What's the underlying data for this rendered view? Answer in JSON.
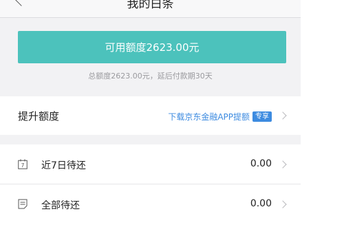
{
  "nav": {
    "title": "我的白条",
    "back_icon": "chevron-left-icon"
  },
  "quota": {
    "button_label": "可用额度2623.00元",
    "description": "总额度2623.00元，延后付款期30天",
    "accent_color": "#4cc2bc"
  },
  "raise": {
    "label": "提升额度",
    "link_text": "下载京东金融APP提额",
    "badge": "专享",
    "link_color": "#3d8be0"
  },
  "list": {
    "items": [
      {
        "icon": "calendar-7-icon",
        "icon_text": "7",
        "label": "近7日待还",
        "value": "0.00"
      },
      {
        "icon": "document-icon",
        "label": "全部待还",
        "value": "0.00"
      }
    ]
  }
}
